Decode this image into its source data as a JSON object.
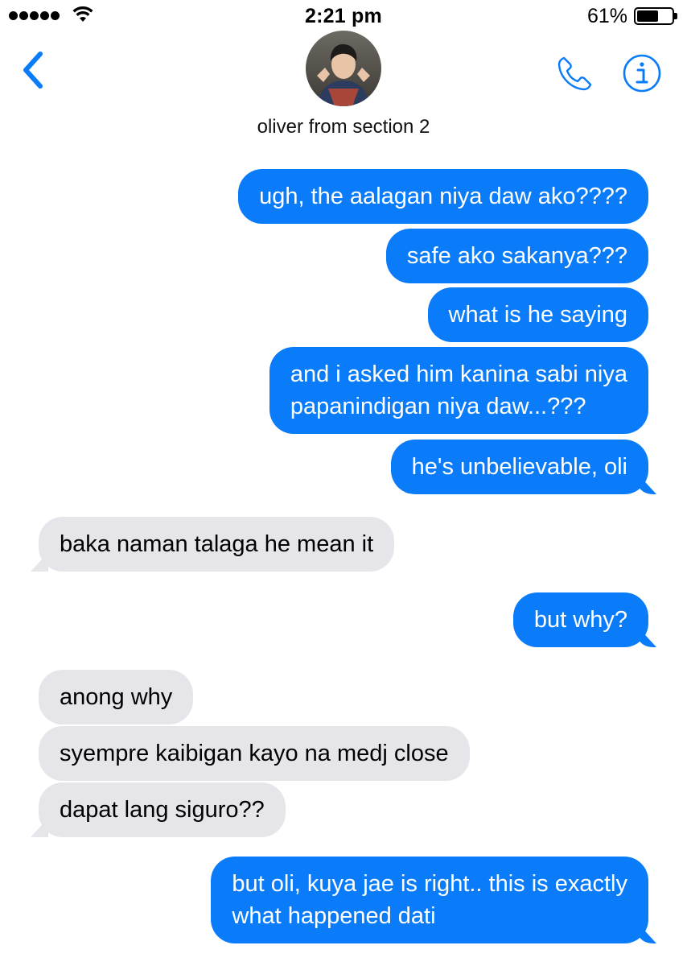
{
  "status_bar": {
    "time": "2:21 pm",
    "battery_percent": "61%",
    "battery_level": 0.61,
    "signal_dots": 5
  },
  "header": {
    "contact_name": "oliver from section 2",
    "back_icon": "chevron-left-icon",
    "call_icon": "phone-icon",
    "info_icon": "info-icon",
    "accent_color": "#0a7cf9"
  },
  "messages": [
    {
      "from": "me",
      "text": "ugh, the aalagan niya daw ako????"
    },
    {
      "from": "me",
      "text": "safe ako sakanya???"
    },
    {
      "from": "me",
      "text": "what is he saying"
    },
    {
      "from": "me",
      "text": "and i asked him kanina sabi niya\npapanindigan niya daw...???"
    },
    {
      "from": "me",
      "text": "he's unbelievable, oli"
    },
    {
      "from": "them",
      "text": "baka naman talaga he mean it"
    },
    {
      "from": "me",
      "text": "but why?"
    },
    {
      "from": "them",
      "text": "anong why"
    },
    {
      "from": "them",
      "text": "syempre kaibigan kayo na medj close"
    },
    {
      "from": "them",
      "text": "dapat lang siguro??"
    },
    {
      "from": "me",
      "text": "but oli, kuya jae is right.. this is exactly\nwhat happened dati"
    }
  ],
  "colors": {
    "sent_bubble": "#0a7cf9",
    "received_bubble": "#e6e5ea"
  }
}
